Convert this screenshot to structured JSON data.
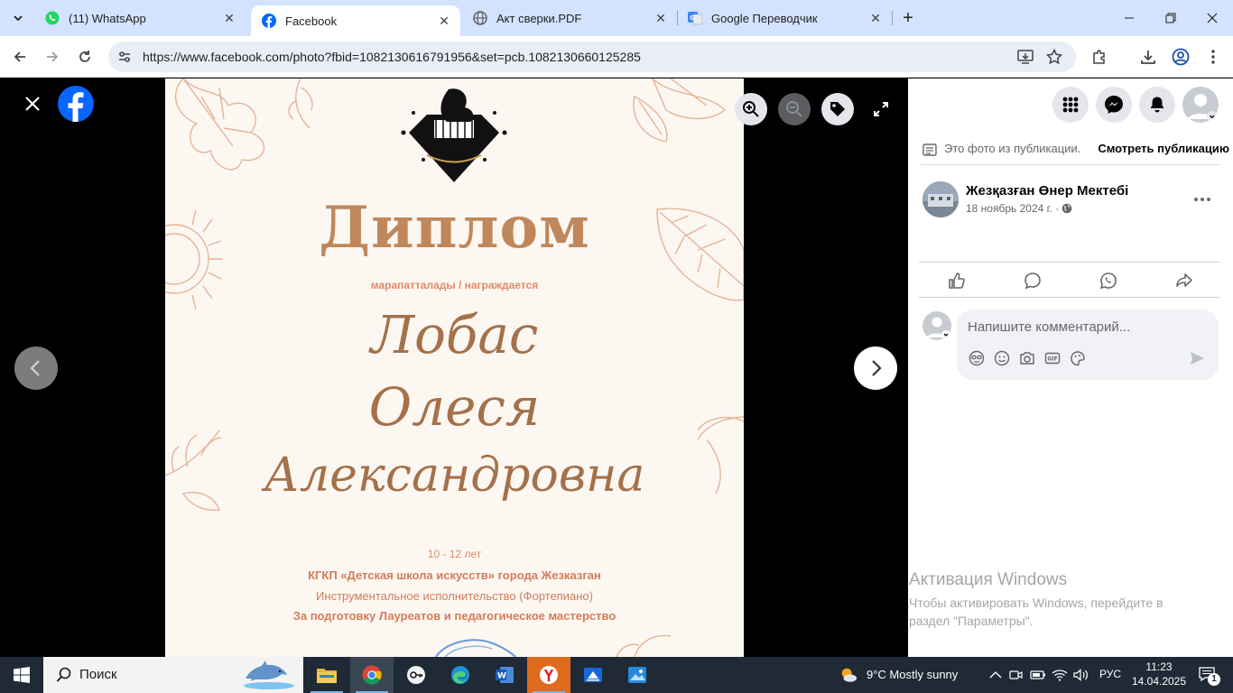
{
  "browser": {
    "tabs": [
      {
        "title": "(11) WhatsApp",
        "icon": "whatsapp-icon",
        "active": false
      },
      {
        "title": "Facebook",
        "icon": "facebook-icon",
        "active": true
      },
      {
        "title": "Акт сверки.PDF",
        "icon": "globe-icon",
        "active": false
      },
      {
        "title": "Google Переводчик",
        "icon": "google-translate-icon",
        "active": false
      }
    ],
    "url": "https://www.facebook.com/photo?fbid=1082130616791956&set=pcb.1082130660125285"
  },
  "photo": {
    "title": "Диплом",
    "subtitle": "марапатталады / награждается",
    "name_line1": "Лобас",
    "name_line2": "Олеся",
    "name_line3": "Александровна",
    "age": "10 - 12 лет",
    "line1": "КГКП «Детская школа искусств» города  Жезказган",
    "line2": "Инструментальное исполнительство (Фортепиано)",
    "line3": "За подготовку Лауреатов и педагогическое мастерство"
  },
  "panel": {
    "from_post_note": "Это фото из публикации.",
    "see_post": "Смотреть публикацию",
    "author": "Жезқазған Өнер Мектебі",
    "date": "18 ноябрь 2024 г. ·",
    "comment_placeholder": "Напишите комментарий..."
  },
  "watermark": {
    "title": "Активация Windows",
    "line1": "Чтобы активировать Windows, перейдите в",
    "line2": "раздел \"Параметры\"."
  },
  "taskbar": {
    "search_label": "Поиск",
    "weather": "9°C  Mostly sunny",
    "language": "РУС",
    "time": "11:23",
    "date": "14.04.2025",
    "notifications": "1"
  },
  "colors": {
    "tabstrip": "#d3e3fd",
    "facebook_blue": "#0866ff",
    "diploma_brown": "#c0875a",
    "diploma_orange": "#d67b57"
  }
}
